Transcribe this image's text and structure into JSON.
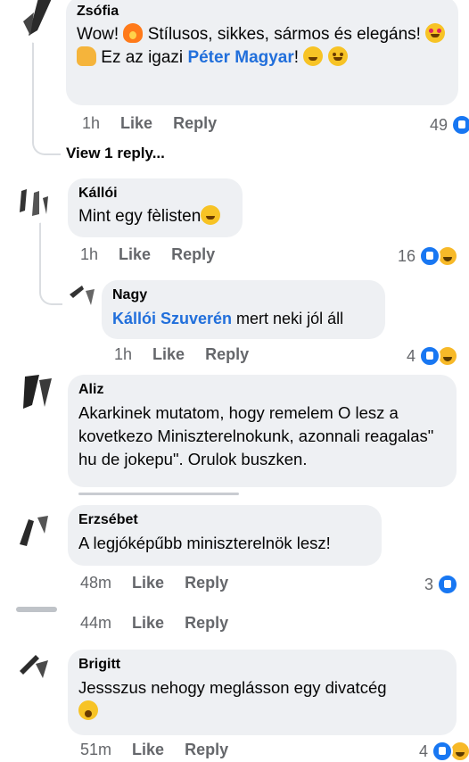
{
  "comments": [
    {
      "author": "Zsófia",
      "text_parts": [
        "Wow! ",
        " Stílusos, sikkes, sármos és elegáns! ",
        " Ez az igazi ",
        "Péter Magyar",
        "! "
      ],
      "time": "1h",
      "like": "Like",
      "reply": "Reply",
      "reactions": "49",
      "view_replies": "View 1 reply..."
    },
    {
      "author": "Kállói",
      "text": "Mint egy fèlisten",
      "time": "1h",
      "like": "Like",
      "reply": "Reply",
      "reactions": "16"
    },
    {
      "author": "Nagy",
      "mention": "Kállói Szuverén",
      "text": " mert neki jól áll",
      "time": "1h",
      "like": "Like",
      "reply": "Reply",
      "reactions": "4"
    },
    {
      "author": "Aliz",
      "text": "Akarkinek mutatom, hogy remelem O lesz a kovetkezo Miniszterelnokunk, azonnali reagalas\" hu de jokepu\". Orulok buszken."
    },
    {
      "author": "Erzsébet",
      "text": "A legjóképűbb miniszterelnök lesz!",
      "time": "48m",
      "like": "Like",
      "reply": "Reply",
      "reactions": "3"
    },
    {
      "time": "44m",
      "like": "Like",
      "reply": "Reply"
    },
    {
      "author": "Brigitt",
      "text": "Jessszus nehogy meglásson egy divatcég",
      "time": "51m",
      "like": "Like",
      "reply": "Reply",
      "reactions": "4"
    }
  ],
  "colors": {
    "mention": "#216fdb",
    "bubble": "#eef0f3",
    "meta": "#65676b",
    "like_reaction": "#1877f2"
  }
}
